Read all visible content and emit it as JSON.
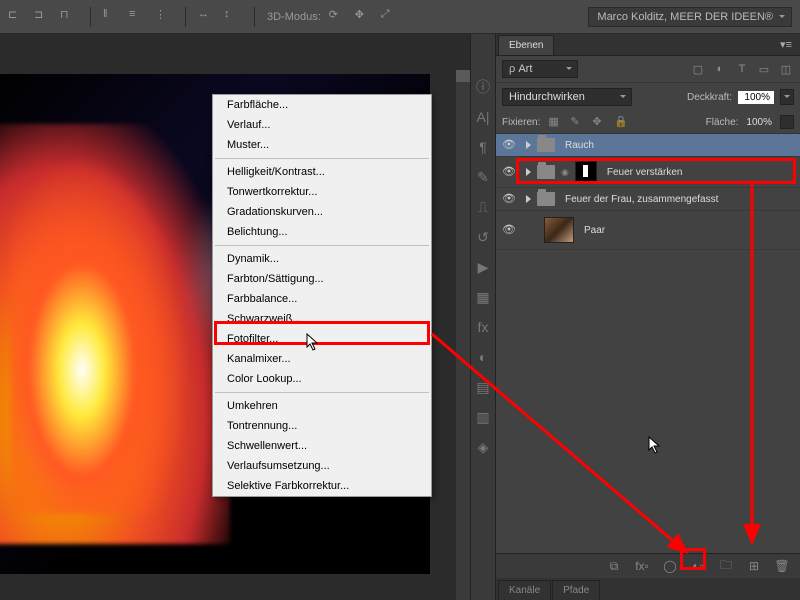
{
  "topbar": {
    "mode3d_label": "3D-Modus:",
    "user": "Marco Kolditz, MEER DER IDEEN®"
  },
  "context_menu": {
    "items": [
      {
        "label": "Farbfläche...",
        "sep": false
      },
      {
        "label": "Verlauf...",
        "sep": false
      },
      {
        "label": "Muster...",
        "sep": true
      },
      {
        "label": "Helligkeit/Kontrast...",
        "sep": false
      },
      {
        "label": "Tonwertkorrektur...",
        "sep": false
      },
      {
        "label": "Gradationskurven...",
        "sep": false
      },
      {
        "label": "Belichtung...",
        "sep": true
      },
      {
        "label": "Dynamik...",
        "sep": false
      },
      {
        "label": "Farbton/Sättigung...",
        "sep": false
      },
      {
        "label": "Farbbalance...",
        "sep": false,
        "highlight": true
      },
      {
        "label": "Schwarzweiß...",
        "sep": false
      },
      {
        "label": "Fotofilter...",
        "sep": false
      },
      {
        "label": "Kanalmixer...",
        "sep": false
      },
      {
        "label": "Color Lookup...",
        "sep": true
      },
      {
        "label": "Umkehren",
        "sep": false
      },
      {
        "label": "Tontrennung...",
        "sep": false
      },
      {
        "label": "Schwellenwert...",
        "sep": false
      },
      {
        "label": "Verlaufsumsetzung...",
        "sep": false
      },
      {
        "label": "Selektive Farbkorrektur...",
        "sep": false
      }
    ]
  },
  "panels": {
    "layers_tab": "Ebenen",
    "search_placeholder": "Art",
    "blend_mode": "Hindurchwirken",
    "opacity_label": "Deckkraft:",
    "opacity_value": "100%",
    "lock_label": "Fixieren:",
    "fill_label": "Fläche:",
    "fill_value": "100%",
    "layers": [
      {
        "name": "Rauch",
        "type": "folder",
        "selected": true
      },
      {
        "name": "Feuer verstärken",
        "type": "folder_masked"
      },
      {
        "name": "Feuer der Frau, zusammengefasst",
        "type": "folder"
      },
      {
        "name": "Paar",
        "type": "image"
      }
    ],
    "channels_tab": "Kanäle",
    "paths_tab": "Pfade"
  }
}
